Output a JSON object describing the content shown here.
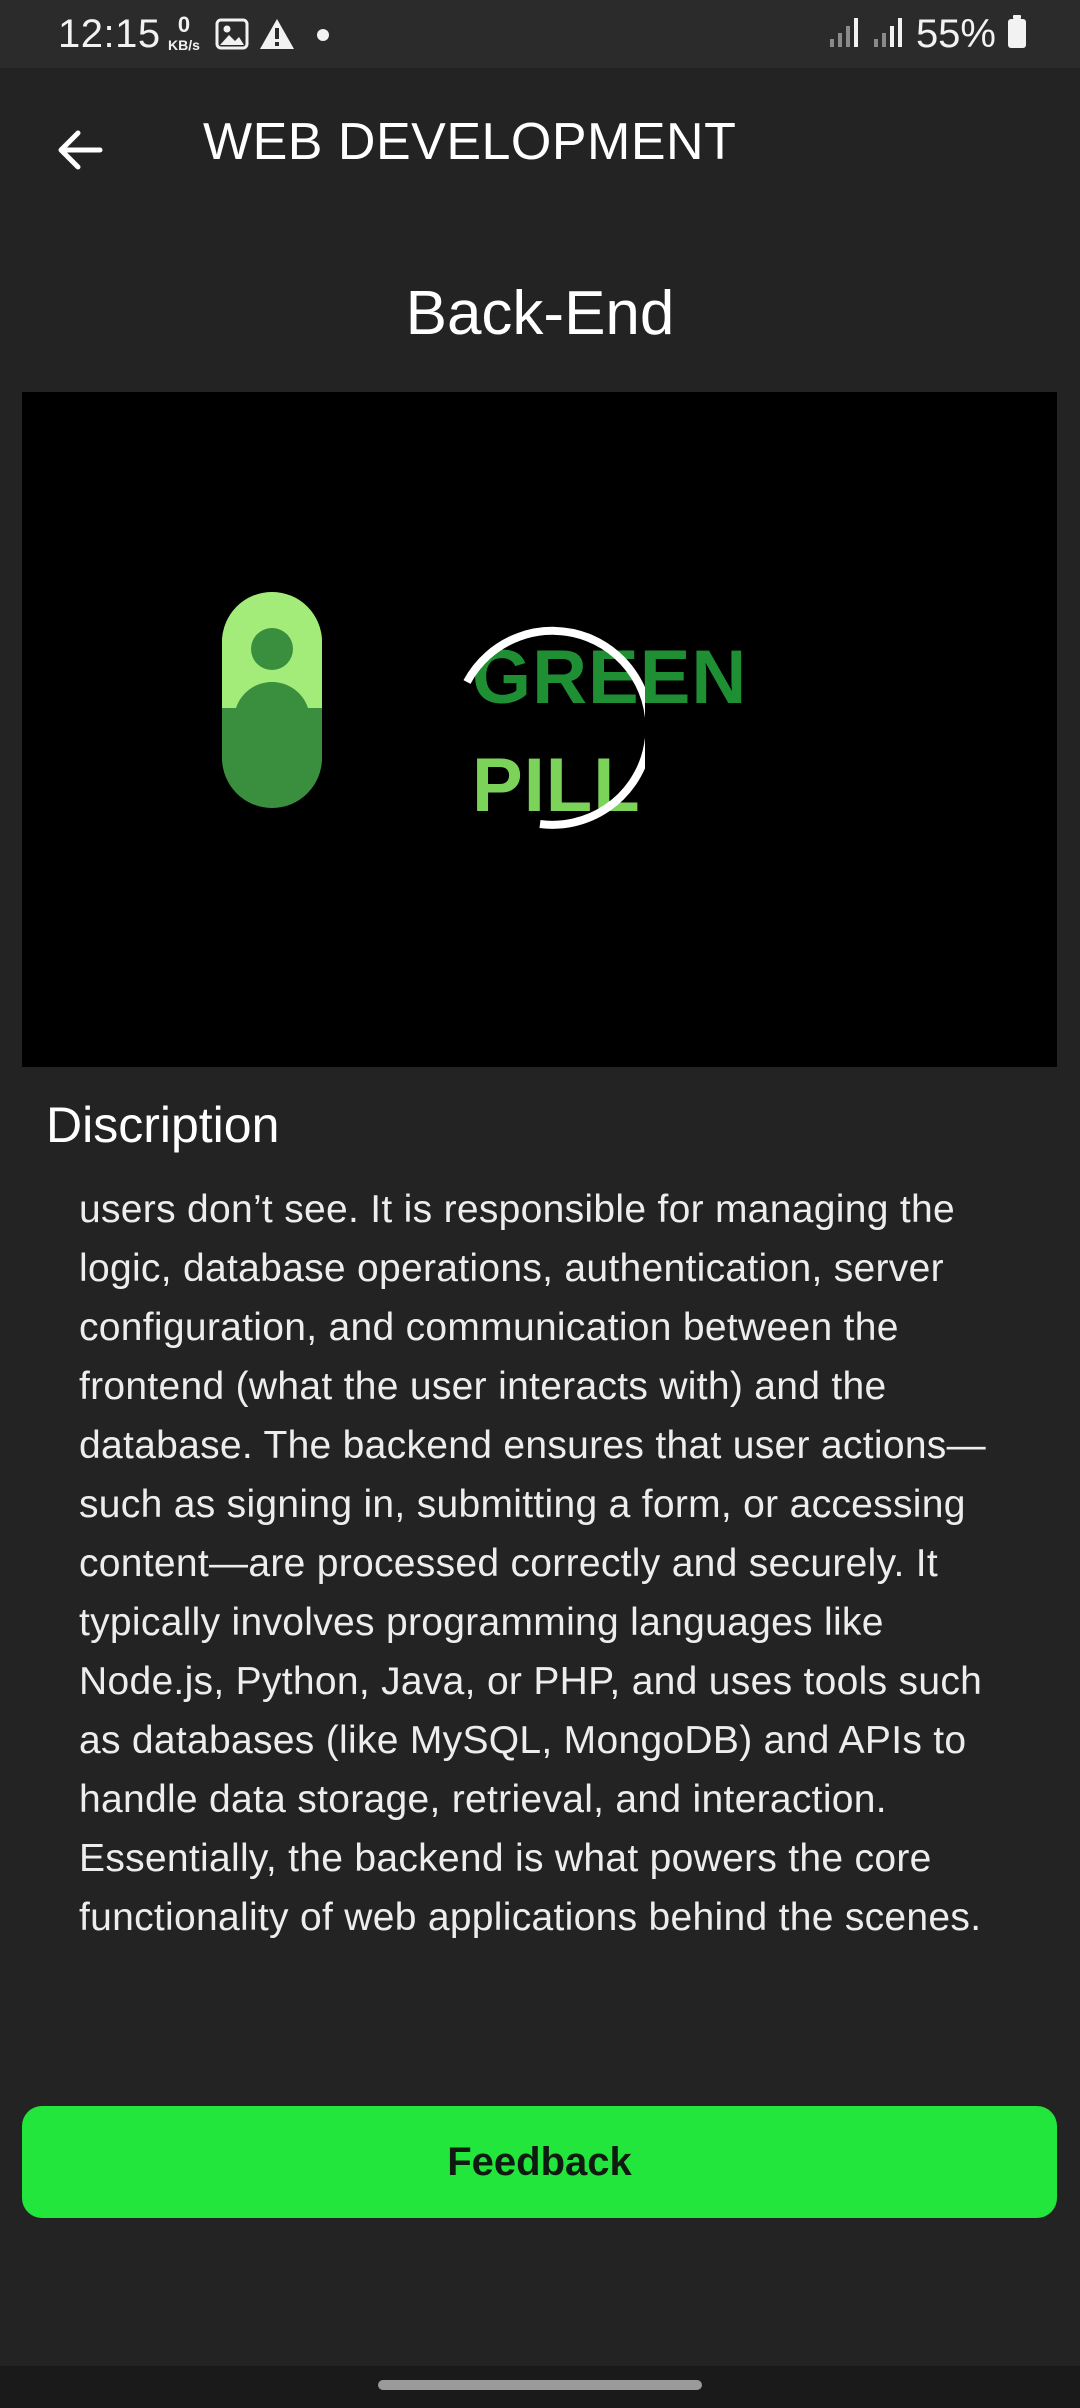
{
  "status_bar": {
    "time": "12:15",
    "net_speed_value": "0",
    "net_speed_unit": "KB/s",
    "battery": "55%",
    "icons": [
      "image-icon",
      "warning-icon",
      "dot-icon",
      "signal-icon",
      "signal-icon",
      "battery-icon"
    ]
  },
  "app_bar": {
    "title": "WEB DEVELOPMENT",
    "back_icon": "arrow-left-icon"
  },
  "page": {
    "title": "Back-End"
  },
  "media": {
    "logo_line1": "GREEN",
    "logo_line2": "PILL",
    "loading": true
  },
  "description": {
    "heading": "Discription",
    "text": "users don’t see. It is responsible for managing the logic, database operations, authentication, server configuration, and communication between the frontend (what the user interacts with) and the database. The backend ensures that user actions—such as signing in, submitting a form, or accessing content—are processed correctly and securely. It typically involves programming languages like Node.js, Python, Java, or PHP, and uses tools such as databases (like MySQL, MongoDB) and APIs to handle data storage, retrieval, and interaction. Essentially, the backend is what powers the core functionality of web applications behind the scenes."
  },
  "feedback": {
    "label": "Feedback"
  },
  "colors": {
    "background": "#232323",
    "status_bar": "#2b2b2b",
    "accent": "#23e63d",
    "logo_dark_green": "#1f8f34",
    "logo_light_green": "#7cd35a"
  }
}
